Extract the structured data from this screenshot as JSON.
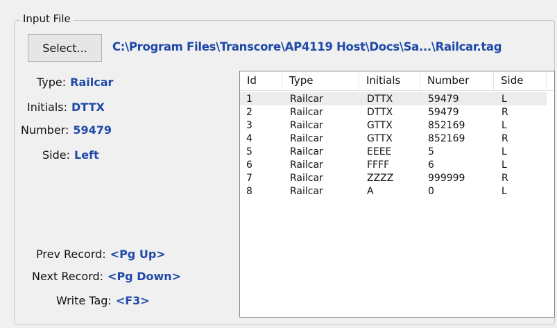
{
  "input_file": {
    "group_title": "Input File",
    "select_label": "Select...",
    "path": "C:\\Program Files\\Transcore\\AP4119 Host\\Docs\\Sa...\\Railcar.tag"
  },
  "details": {
    "type_label": "Type:",
    "type_value": "Railcar",
    "initials_label": "Initials:",
    "initials_value": "DTTX",
    "number_label": "Number:",
    "number_value": "59479",
    "side_label": "Side:",
    "side_value": "Left"
  },
  "shortcuts": {
    "prev_label": "Prev Record:",
    "prev_key": "<Pg Up>",
    "next_label": "Next Record:",
    "next_key": "<Pg Down>",
    "write_label": "Write Tag:",
    "write_key": "<F3>"
  },
  "table": {
    "columns": [
      "Id",
      "Type",
      "Initials",
      "Number",
      "Side"
    ],
    "rows": [
      [
        "1",
        "Railcar",
        "DTTX",
        "59479",
        "L"
      ],
      [
        "2",
        "Railcar",
        "DTTX",
        "59479",
        "R"
      ],
      [
        "3",
        "Railcar",
        "GTTX",
        "852169",
        "L"
      ],
      [
        "4",
        "Railcar",
        "GTTX",
        "852169",
        "R"
      ],
      [
        "5",
        "Railcar",
        "EEEE",
        "5",
        "L"
      ],
      [
        "6",
        "Railcar",
        "FFFF",
        "6",
        "L"
      ],
      [
        "7",
        "Railcar",
        "ZZZZ",
        "999999",
        "R"
      ],
      [
        "8",
        "Railcar",
        "A",
        "0",
        "L"
      ]
    ],
    "selected_row": 0
  },
  "colors": {
    "value_blue": "#1f49a8",
    "window_bg": "#f0f0f0"
  }
}
